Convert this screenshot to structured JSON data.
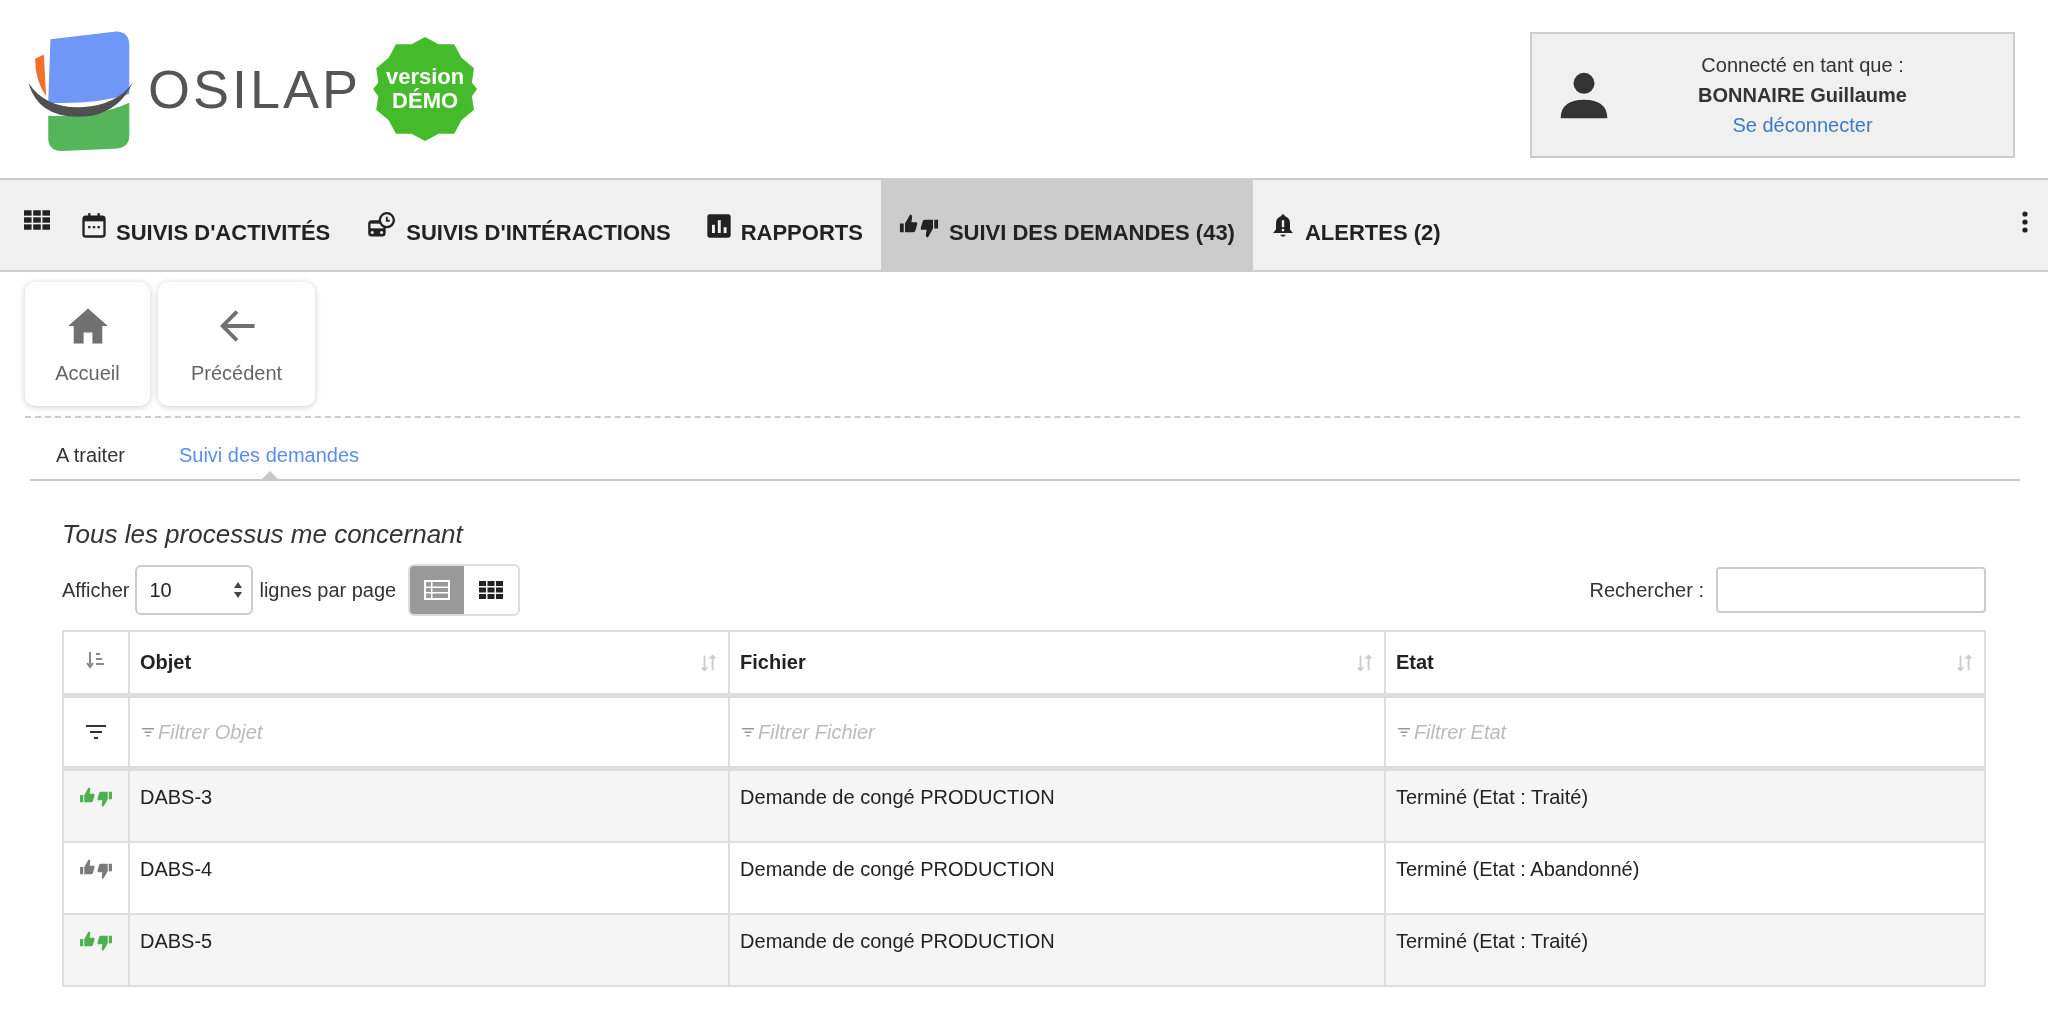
{
  "header": {
    "logo_text": "OSILAP",
    "badge": "version DÉMO",
    "user": {
      "label": "Connecté en tant que :",
      "name": "BONNAIRE Guillaume",
      "logout": "Se déconnecter"
    }
  },
  "nav": {
    "items": [
      {
        "label": "SUIVIS D'ACTIVITÉS",
        "selected": false
      },
      {
        "label": "SUIVIS D'INTÉRACTIONS",
        "selected": false
      },
      {
        "label": "RAPPORTS",
        "selected": false
      },
      {
        "label": "SUIVI DES DEMANDES (43)",
        "selected": true
      },
      {
        "label": "ALERTES (2)",
        "selected": false
      }
    ]
  },
  "quick_buttons": [
    {
      "label": "Accueil"
    },
    {
      "label": "Précédent"
    }
  ],
  "tabs": [
    {
      "label": "A traiter",
      "selected": false
    },
    {
      "label": "Suivi des demandes",
      "selected": true
    }
  ],
  "section_title": "Tous les processus me concernant",
  "length": {
    "prefix": "Afficher",
    "value": "10",
    "suffix": "lignes par page"
  },
  "view_toggle": [
    {
      "selected": true
    },
    {
      "selected": false
    }
  ],
  "search": {
    "label": "Rechercher :"
  },
  "table": {
    "columns": [
      "Objet",
      "Fichier",
      "Etat"
    ],
    "filters": [
      {
        "placeholder": "Filtrer Objet"
      },
      {
        "placeholder": "Filtrer Fichier"
      },
      {
        "placeholder": "Filtrer Etat"
      }
    ],
    "rows": [
      {
        "color": "#4caf50",
        "cells": [
          "DABS-3",
          "Demande de congé PRODUCTION",
          "Terminé (Etat : Traité)"
        ]
      },
      {
        "color": "#7a7a7a",
        "cells": [
          "DABS-4",
          "Demande de congé PRODUCTION",
          "Terminé (Etat : Abandonné)"
        ]
      },
      {
        "color": "#4caf50",
        "cells": [
          "DABS-5",
          "Demande de congé PRODUCTION",
          "Terminé (Etat : Traité)"
        ]
      }
    ]
  }
}
